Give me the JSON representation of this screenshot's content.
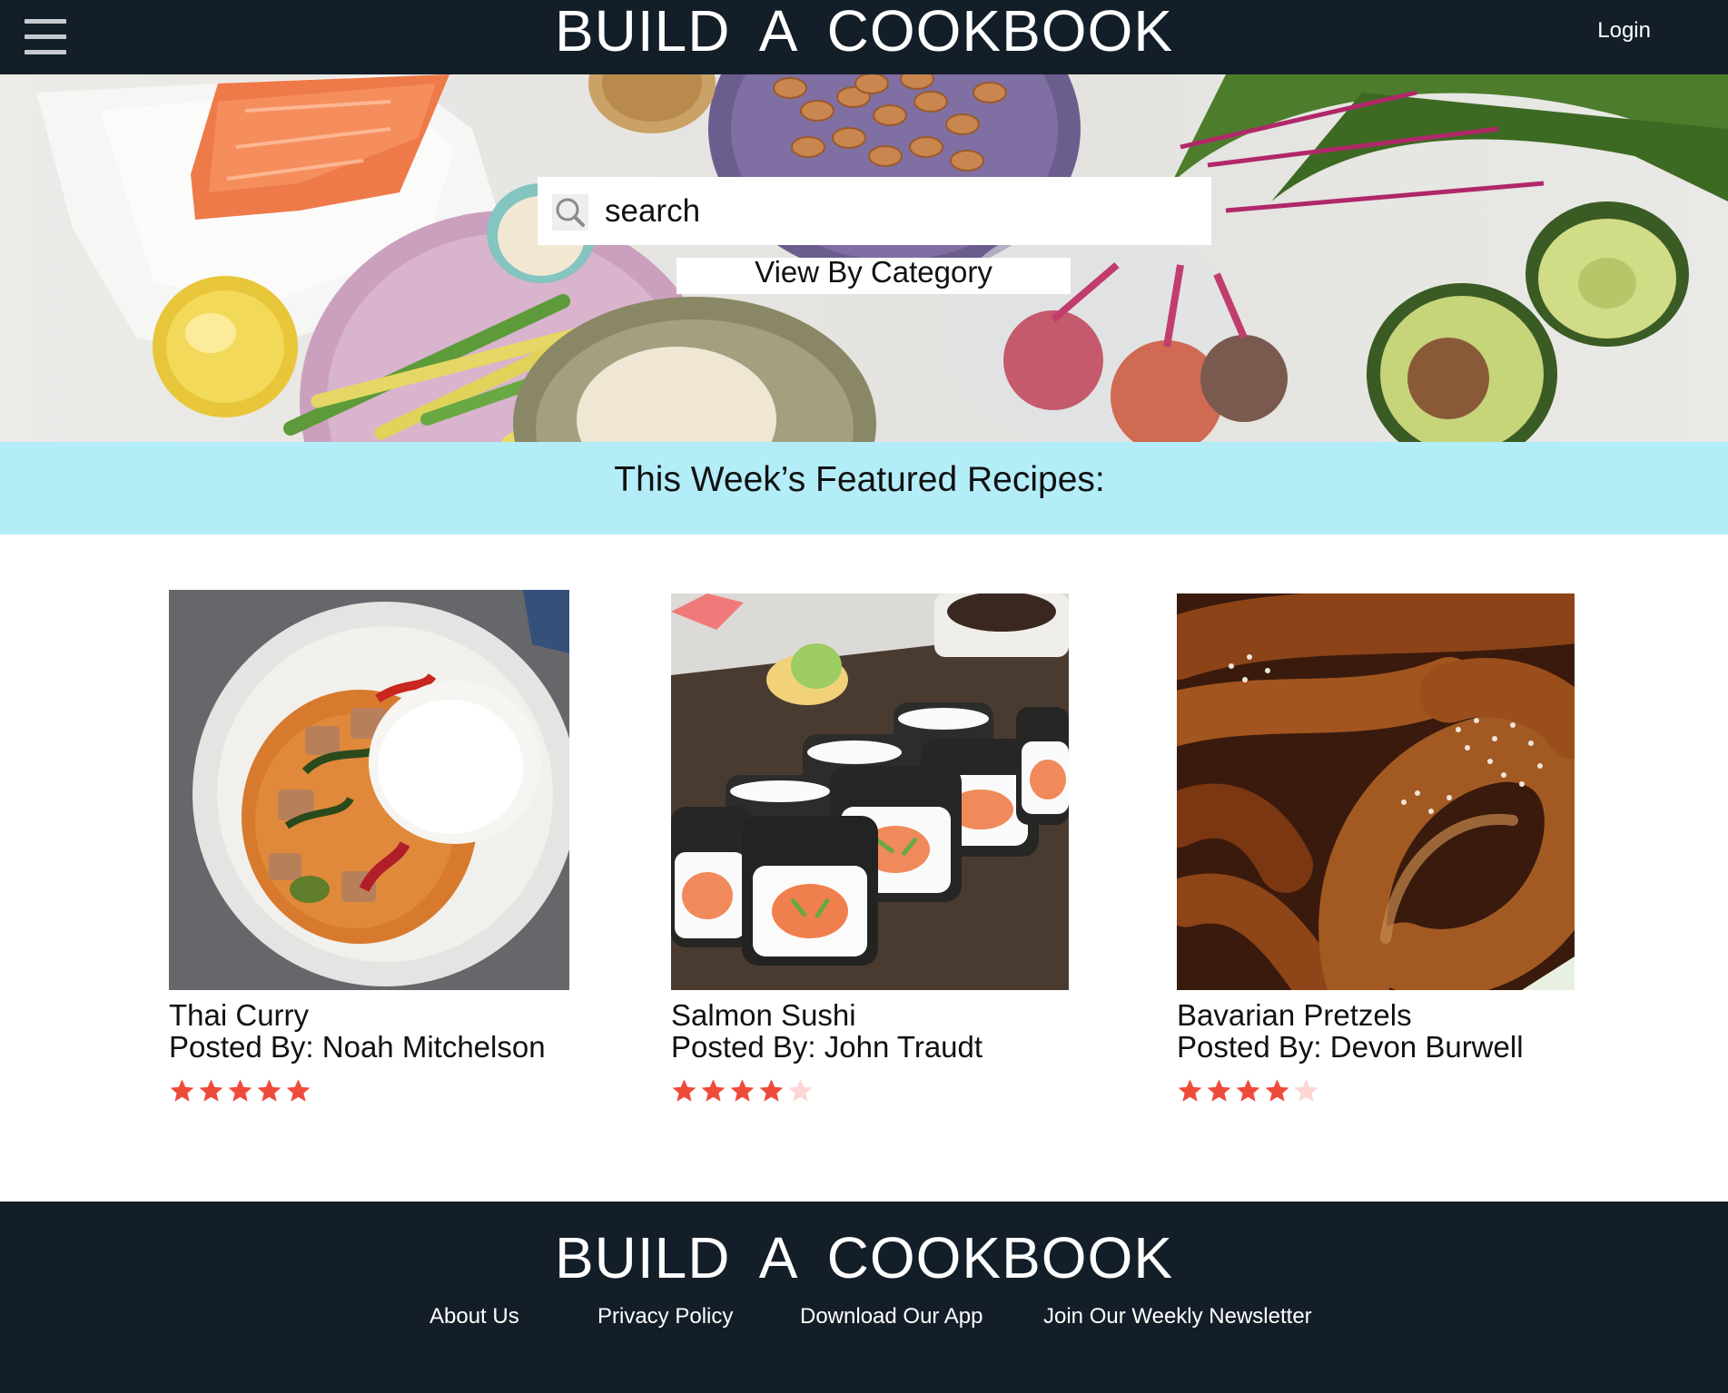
{
  "header": {
    "menu_icon": "hamburger-menu-icon",
    "title": "BUILD A COOKBOOK",
    "login_label": "Login"
  },
  "hero": {
    "search_icon": "search-icon",
    "search_text": "search",
    "category_button_label": "View By Category"
  },
  "featured": {
    "title": "This Week’s Featured Recipes:",
    "star_color": "#ee4b3b",
    "star_empty_color": "#fbd6d2",
    "recipes": [
      {
        "name": "Thai Curry",
        "author_label": "Posted By: ",
        "author": "Noah Mitchelson",
        "rating": 5,
        "rating_max": 5
      },
      {
        "name": "Salmon Sushi",
        "author_label": "Posted By: ",
        "author": "John Traudt",
        "rating": 4,
        "rating_max": 5
      },
      {
        "name": "Bavarian Pretzels",
        "author_label": "Posted By: ",
        "author": "Devon Burwell",
        "rating": 4,
        "rating_max": 5
      }
    ]
  },
  "footer": {
    "title": "BUILD A COOKBOOK",
    "links": [
      "About Us",
      "Privacy Policy",
      "Download Our App",
      "Join Our Weekly Newsletter"
    ]
  },
  "colors": {
    "nav_background": "#141e28",
    "featured_band": "#b3edf8",
    "text_light": "#ffffff"
  }
}
